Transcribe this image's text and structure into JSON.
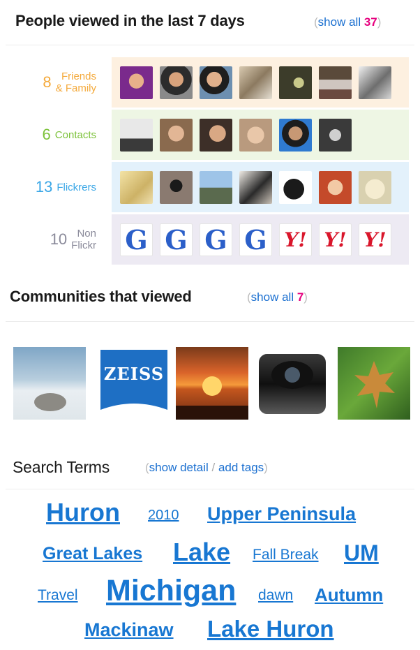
{
  "people": {
    "title": "People viewed in the last 7 days",
    "show_all_label": "show all",
    "show_all_count": "37",
    "rows": [
      {
        "count": "8",
        "label_line1": "Friends",
        "label_line2": "& Family",
        "color": "#f4a93a",
        "panel_color": "#fdf0e0"
      },
      {
        "count": "6",
        "label_line1": "Contacts",
        "label_line2": "",
        "color": "#7cc23a",
        "panel_color": "#eef6e4"
      },
      {
        "count": "13",
        "label_line1": "Flickrers",
        "label_line2": "",
        "color": "#39a6e6",
        "panel_color": "#e3f1fb"
      },
      {
        "count": "10",
        "label_line1": "Non",
        "label_line2": "Flickr",
        "color": "#8a8a9a",
        "panel_color": "#edeaf3"
      }
    ],
    "non_flickr_icons": [
      "G",
      "G",
      "G",
      "G",
      "Y!",
      "Y!",
      "Y!"
    ]
  },
  "communities": {
    "title": "Communities that viewed",
    "show_all_label": "show all",
    "show_all_count": "7",
    "items": [
      {
        "name": "frozen-lake-shore-thumb"
      },
      {
        "name": "zeiss-logo-thumb",
        "text": "ZEISS"
      },
      {
        "name": "sunset-lake-thumb"
      },
      {
        "name": "camera-lens-thumb"
      },
      {
        "name": "autumn-leaf-thumb"
      }
    ]
  },
  "search_terms": {
    "title": "Search Terms",
    "show_detail_label": "show detail",
    "separator": "/",
    "add_tags_label": "add tags",
    "tags": [
      {
        "text": "Huron"
      },
      {
        "text": "2010"
      },
      {
        "text": "Upper Peninsula"
      },
      {
        "text": "Great Lakes"
      },
      {
        "text": "Lake"
      },
      {
        "text": "Fall Break"
      },
      {
        "text": "UM"
      },
      {
        "text": "Travel"
      },
      {
        "text": "Michigan"
      },
      {
        "text": "dawn"
      },
      {
        "text": "Autumn"
      },
      {
        "text": "Mackinaw"
      },
      {
        "text": "Lake Huron"
      }
    ]
  },
  "colors": {
    "link": "#1a6fd0",
    "count_pink": "#e6007e",
    "tag_blue": "#1877d2"
  }
}
